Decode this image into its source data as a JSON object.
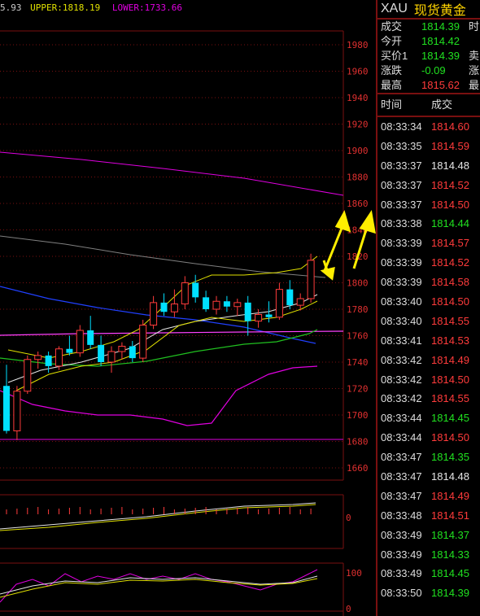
{
  "indicator_bar": {
    "first": "5.93",
    "upper": "UPPER:1818.19",
    "lower": "LOWER:1733.66"
  },
  "colors": {
    "up": "#ff3b3b",
    "down": "#20e020",
    "neutral": "#e6e6e6",
    "upper_band": "#e0e000",
    "lower_band": "#e000e0",
    "grid": "#7a1010"
  },
  "chart_data": {
    "type": "candlestick",
    "price_axis": [
      "1980",
      "1960",
      "1940",
      "1920",
      "1900",
      "1880",
      "1860",
      "1840",
      "1820",
      "1800",
      "1780",
      "1760",
      "1740",
      "1720",
      "1700",
      "1680",
      "1660"
    ],
    "ylim": [
      1650,
      1990
    ],
    "candles": [
      {
        "o": 1722,
        "h": 1738,
        "l": 1686,
        "c": 1688
      },
      {
        "o": 1688,
        "h": 1722,
        "l": 1681,
        "c": 1718
      },
      {
        "o": 1718,
        "h": 1745,
        "l": 1716,
        "c": 1742
      },
      {
        "o": 1742,
        "h": 1748,
        "l": 1735,
        "c": 1745
      },
      {
        "o": 1745,
        "h": 1748,
        "l": 1732,
        "c": 1737
      },
      {
        "o": 1737,
        "h": 1752,
        "l": 1734,
        "c": 1750
      },
      {
        "o": 1750,
        "h": 1760,
        "l": 1745,
        "c": 1747
      },
      {
        "o": 1747,
        "h": 1768,
        "l": 1744,
        "c": 1764
      },
      {
        "o": 1764,
        "h": 1775,
        "l": 1750,
        "c": 1753
      },
      {
        "o": 1753,
        "h": 1760,
        "l": 1737,
        "c": 1740
      },
      {
        "o": 1740,
        "h": 1752,
        "l": 1732,
        "c": 1748
      },
      {
        "o": 1748,
        "h": 1755,
        "l": 1742,
        "c": 1752
      },
      {
        "o": 1752,
        "h": 1756,
        "l": 1740,
        "c": 1743
      },
      {
        "o": 1743,
        "h": 1772,
        "l": 1740,
        "c": 1768
      },
      {
        "o": 1768,
        "h": 1790,
        "l": 1765,
        "c": 1785
      },
      {
        "o": 1785,
        "h": 1792,
        "l": 1775,
        "c": 1778
      },
      {
        "o": 1778,
        "h": 1795,
        "l": 1774,
        "c": 1784
      },
      {
        "o": 1784,
        "h": 1805,
        "l": 1780,
        "c": 1800
      },
      {
        "o": 1800,
        "h": 1806,
        "l": 1785,
        "c": 1789
      },
      {
        "o": 1789,
        "h": 1794,
        "l": 1778,
        "c": 1780
      },
      {
        "o": 1780,
        "h": 1790,
        "l": 1776,
        "c": 1786
      },
      {
        "o": 1786,
        "h": 1790,
        "l": 1778,
        "c": 1782
      },
      {
        "o": 1782,
        "h": 1788,
        "l": 1775,
        "c": 1785
      },
      {
        "o": 1785,
        "h": 1790,
        "l": 1760,
        "c": 1771
      },
      {
        "o": 1771,
        "h": 1780,
        "l": 1766,
        "c": 1776
      },
      {
        "o": 1776,
        "h": 1786,
        "l": 1770,
        "c": 1774
      },
      {
        "o": 1774,
        "h": 1800,
        "l": 1772,
        "c": 1795
      },
      {
        "o": 1795,
        "h": 1802,
        "l": 1780,
        "c": 1783
      },
      {
        "o": 1783,
        "h": 1792,
        "l": 1779,
        "c": 1788
      },
      {
        "o": 1788,
        "h": 1822,
        "l": 1785,
        "c": 1817
      }
    ],
    "upper_band_label": "UPPER:1818.19",
    "lower_band_label": "LOWER:1733.66",
    "macd_axis": "0",
    "kdj_axis": [
      "100",
      "0"
    ]
  },
  "quote": {
    "symbol": "XAU",
    "name": "现货黄金",
    "rows": [
      {
        "label": "成交",
        "value": "1814.39",
        "color": "green",
        "extra": "时"
      },
      {
        "label": "今开",
        "value": "1814.42",
        "color": "green",
        "extra": ""
      },
      {
        "label": "买价1",
        "value": "1814.39",
        "color": "green",
        "extra": "卖"
      },
      {
        "label": "涨跌",
        "value": "-0.09",
        "color": "green",
        "extra": "涨"
      },
      {
        "label": "最高",
        "value": "1815.62",
        "color": "red",
        "extra": "最"
      }
    ]
  },
  "ticks": {
    "headers": [
      "时间",
      "成交"
    ],
    "rows": [
      {
        "time": "08:33:34",
        "price": "1814.60",
        "color": "red"
      },
      {
        "time": "08:33:35",
        "price": "1814.59",
        "color": "red"
      },
      {
        "time": "08:33:37",
        "price": "1814.48",
        "color": "white"
      },
      {
        "time": "08:33:37",
        "price": "1814.52",
        "color": "red"
      },
      {
        "time": "08:33:37",
        "price": "1814.50",
        "color": "red"
      },
      {
        "time": "08:33:38",
        "price": "1814.44",
        "color": "green"
      },
      {
        "time": "08:33:39",
        "price": "1814.57",
        "color": "red"
      },
      {
        "time": "08:33:39",
        "price": "1814.52",
        "color": "red"
      },
      {
        "time": "08:33:39",
        "price": "1814.58",
        "color": "red"
      },
      {
        "time": "08:33:40",
        "price": "1814.50",
        "color": "red"
      },
      {
        "time": "08:33:40",
        "price": "1814.55",
        "color": "red"
      },
      {
        "time": "08:33:41",
        "price": "1814.53",
        "color": "red"
      },
      {
        "time": "08:33:42",
        "price": "1814.49",
        "color": "red"
      },
      {
        "time": "08:33:42",
        "price": "1814.50",
        "color": "red"
      },
      {
        "time": "08:33:42",
        "price": "1814.55",
        "color": "red"
      },
      {
        "time": "08:33:44",
        "price": "1814.45",
        "color": "green"
      },
      {
        "time": "08:33:44",
        "price": "1814.50",
        "color": "red"
      },
      {
        "time": "08:33:47",
        "price": "1814.35",
        "color": "green"
      },
      {
        "time": "08:33:47",
        "price": "1814.48",
        "color": "white"
      },
      {
        "time": "08:33:47",
        "price": "1814.49",
        "color": "red"
      },
      {
        "time": "08:33:48",
        "price": "1814.51",
        "color": "red"
      },
      {
        "time": "08:33:49",
        "price": "1814.37",
        "color": "green"
      },
      {
        "time": "08:33:49",
        "price": "1814.33",
        "color": "green"
      },
      {
        "time": "08:33:49",
        "price": "1814.45",
        "color": "green"
      },
      {
        "time": "08:33:50",
        "price": "1814.39",
        "color": "green"
      }
    ]
  }
}
